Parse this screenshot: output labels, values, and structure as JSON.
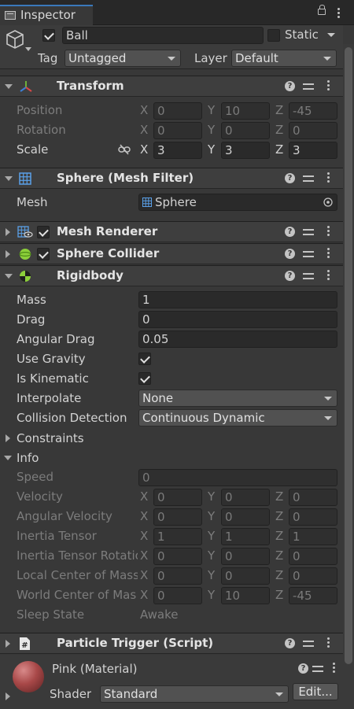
{
  "window": {
    "tab_title": "Inspector"
  },
  "gameobject": {
    "active": true,
    "name": "Ball",
    "static_label": "Static",
    "static_checked": false,
    "tag_label": "Tag",
    "tag_value": "Untagged",
    "layer_label": "Layer",
    "layer_value": "Default"
  },
  "components": {
    "transform": {
      "title": "Transform",
      "position": {
        "label": "Position",
        "x": "0",
        "y": "10",
        "z": "-45"
      },
      "rotation": {
        "label": "Rotation",
        "x": "0",
        "y": "0",
        "z": "0"
      },
      "scale": {
        "label": "Scale",
        "x": "3",
        "y": "3",
        "z": "3"
      }
    },
    "mesh_filter": {
      "title": "Sphere (Mesh Filter)",
      "mesh_label": "Mesh",
      "mesh_value": "Sphere"
    },
    "mesh_renderer": {
      "title": "Mesh Renderer",
      "enabled": true
    },
    "sphere_collider": {
      "title": "Sphere Collider",
      "enabled": true
    },
    "rigidbody": {
      "title": "Rigidbody",
      "mass": {
        "label": "Mass",
        "value": "1"
      },
      "drag": {
        "label": "Drag",
        "value": "0"
      },
      "angular_drag": {
        "label": "Angular Drag",
        "value": "0.05"
      },
      "use_gravity": {
        "label": "Use Gravity",
        "checked": true
      },
      "is_kinematic": {
        "label": "Is Kinematic",
        "checked": true
      },
      "interpolate": {
        "label": "Interpolate",
        "value": "None"
      },
      "collision_detection": {
        "label": "Collision Detection",
        "value": "Continuous Dynamic"
      },
      "constraints_label": "Constraints",
      "info": {
        "label": "Info",
        "speed": {
          "label": "Speed",
          "value": "0"
        },
        "velocity": {
          "label": "Velocity",
          "x": "0",
          "y": "0",
          "z": "0"
        },
        "angular_velocity": {
          "label": "Angular Velocity",
          "x": "0",
          "y": "0",
          "z": "0"
        },
        "inertia_tensor": {
          "label": "Inertia Tensor",
          "x": "1",
          "y": "1",
          "z": "1"
        },
        "inertia_tensor_rotation": {
          "label": "Inertia Tensor Rotatio",
          "x": "0",
          "y": "0",
          "z": "0"
        },
        "local_center_of_mass": {
          "label": "Local Center of Mass",
          "x": "0",
          "y": "0",
          "z": "0"
        },
        "world_center_of_mass": {
          "label": "World Center of Mas",
          "x": "0",
          "y": "10",
          "z": "-45"
        },
        "sleep_state": {
          "label": "Sleep State",
          "value": "Awake"
        }
      }
    },
    "particle_trigger": {
      "title": "Particle Trigger (Script)"
    },
    "material": {
      "title": "Pink (Material)",
      "shader_label": "Shader",
      "shader_value": "Standard",
      "edit_label": "Edit..."
    }
  },
  "axes": {
    "x": "X",
    "y": "Y",
    "z": "Z"
  },
  "icons": {
    "help": "?"
  }
}
